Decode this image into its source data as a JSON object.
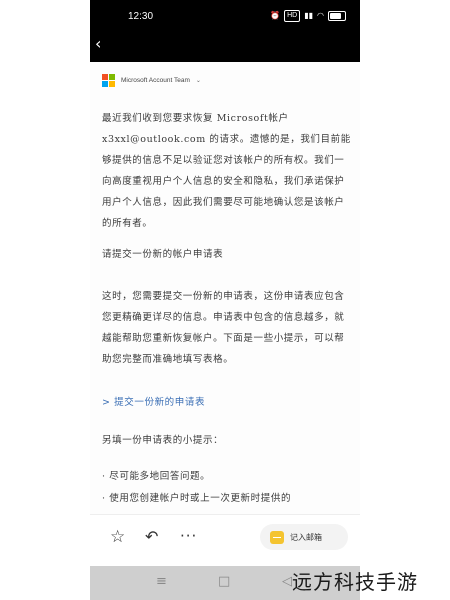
{
  "status_bar": {
    "time": "12:30",
    "icons": [
      "alarm-icon",
      "hd-icon",
      "signal-icon",
      "wifi-icon",
      "battery-icon"
    ],
    "hd_label": "HD",
    "battery_percent": 80
  },
  "header": {
    "back_icon": "chevron-left-icon"
  },
  "email": {
    "sender": "Microsoft Account Team",
    "paragraph1": "最近我们收到您要求恢复 Microsoft帐户 x3xxl@outlook.com 的请求。遗憾的是，我们目前能够提供的信息不足以验证您对该帐户的所有权。我们一向高度重视用户个人信息的安全和隐私，我们承诺保护用户个人信息，因此我们需要尽可能地确认您是该帐户的所有者。",
    "heading": "请提交一份新的帐户申请表",
    "paragraph2": "这时，您需要提交一份新的申请表，这份申请表应包含您更精确更详尽的信息。申请表中包含的信息越多，就越能帮助您重新恢复帐户。下面是一些小提示，可以帮助您完整而准确地填写表格。",
    "link": "> 提交一份新的申请表",
    "tips_heading": "另填一份申请表的小提示：",
    "tip1": "· 尽可能多地回答问题。",
    "tip2": "· 使用您创建帐户时或上一次更新时提供的"
  },
  "bottom_bar": {
    "star_icon": "star-icon",
    "reply_icon": "reply-icon",
    "more_icon": "more-icon",
    "note_label": "记入邮箱"
  },
  "nav_bar": {
    "menu": "≡",
    "home": "□",
    "back": "◁"
  },
  "watermark": "远方科技手游",
  "colors": {
    "ms_red": "#f25022",
    "ms_green": "#7fba00",
    "ms_blue": "#00a4ef",
    "ms_yellow": "#ffb900",
    "link": "#3b6fb5",
    "note_icon": "#f4c430"
  }
}
